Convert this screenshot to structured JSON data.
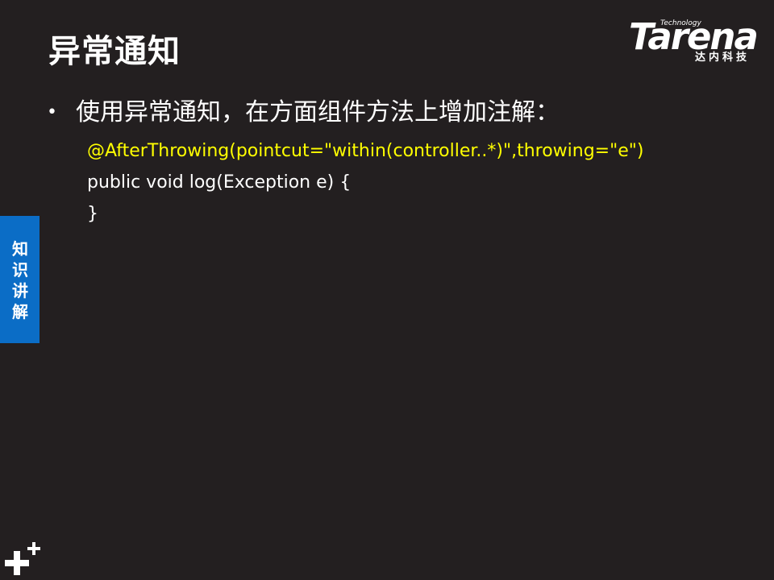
{
  "slide": {
    "title": "异常通知",
    "bullet_text": "使用异常通知，在方面组件方法上增加注解：",
    "code_lines": [
      "@AfterThrowing(pointcut=\"within(controller..*)\",throwing=\"e\")",
      "public void log(Exception e) {",
      "}"
    ]
  },
  "logo": {
    "small_text": "Technology",
    "word": "Tarena",
    "cn_text": "达内科技"
  },
  "side_tab": {
    "label": "知识讲解"
  },
  "icons": {
    "bullet": "bullet-dot-icon",
    "corner": "plus-icon"
  },
  "colors": {
    "background": "#231f20",
    "accent_blue": "#0b6dc6",
    "code_highlight": "#ffff00",
    "text": "#ffffff"
  }
}
